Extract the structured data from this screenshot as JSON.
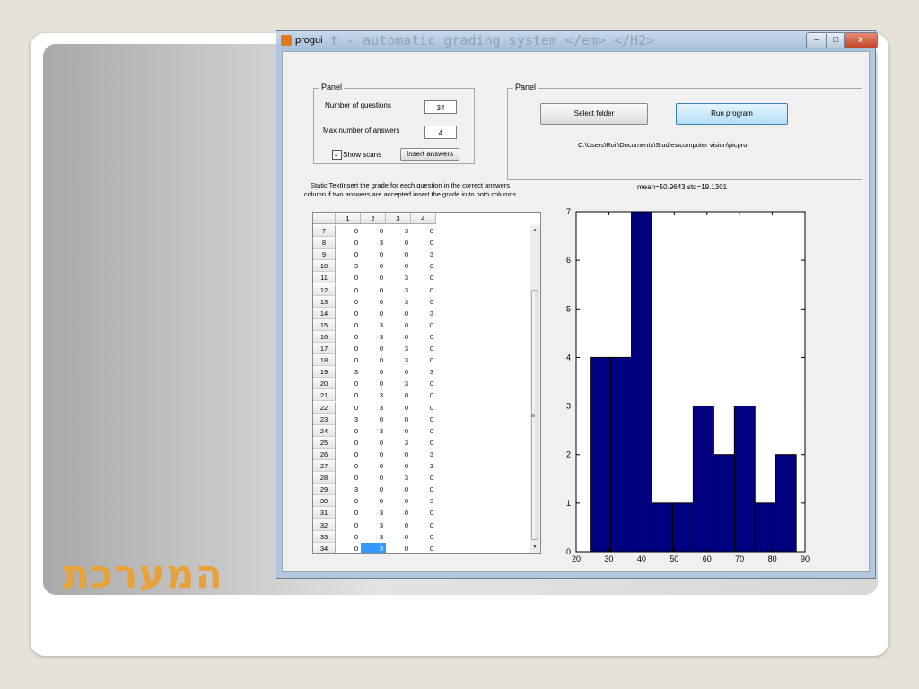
{
  "slide": {
    "title": "המערכת"
  },
  "window": {
    "title": "progui",
    "ghost_text": "t - automatic grading system </em> </H2>",
    "minimize": "–",
    "maximize": "□",
    "close": "x"
  },
  "left_panel": {
    "label": "Panel",
    "num_questions_label": "Number of questions",
    "num_questions_value": "34",
    "max_answers_label": "Max number of answers",
    "max_answers_value": "4",
    "show_scans_label": "Show scans",
    "show_scans_checked": true,
    "insert_answers_label": "Insert answers"
  },
  "right_panel": {
    "label": "Panel",
    "select_folder_label": "Select folder",
    "run_program_label": "Run program",
    "path": "C:\\Users\\Roii\\Documents\\Studies\\computer vision\\picpro"
  },
  "instructions": "Static TextInsert the grade for each question in the correct answers column if two answers are accepted insert the grade in to both columns",
  "stats": "mean=50.9643  std=19.1301",
  "table": {
    "columns": [
      "1",
      "2",
      "3",
      "4"
    ],
    "rows": [
      {
        "label": "7",
        "cells": [
          "0",
          "0",
          "3",
          "0"
        ]
      },
      {
        "label": "8",
        "cells": [
          "0",
          "3",
          "0",
          "0"
        ]
      },
      {
        "label": "9",
        "cells": [
          "0",
          "0",
          "0",
          "3"
        ]
      },
      {
        "label": "10",
        "cells": [
          "3",
          "0",
          "0",
          "0"
        ]
      },
      {
        "label": "11",
        "cells": [
          "0",
          "0",
          "3",
          "0"
        ]
      },
      {
        "label": "12",
        "cells": [
          "0",
          "0",
          "3",
          "0"
        ]
      },
      {
        "label": "13",
        "cells": [
          "0",
          "0",
          "3",
          "0"
        ]
      },
      {
        "label": "14",
        "cells": [
          "0",
          "0",
          "0",
          "3"
        ]
      },
      {
        "label": "15",
        "cells": [
          "0",
          "3",
          "0",
          "0"
        ]
      },
      {
        "label": "16",
        "cells": [
          "0",
          "3",
          "0",
          "0"
        ]
      },
      {
        "label": "17",
        "cells": [
          "0",
          "0",
          "3",
          "0"
        ]
      },
      {
        "label": "18",
        "cells": [
          "0",
          "0",
          "3",
          "0"
        ]
      },
      {
        "label": "19",
        "cells": [
          "3",
          "0",
          "0",
          "3"
        ]
      },
      {
        "label": "20",
        "cells": [
          "0",
          "0",
          "3",
          "0"
        ]
      },
      {
        "label": "21",
        "cells": [
          "0",
          "3",
          "0",
          "0"
        ]
      },
      {
        "label": "22",
        "cells": [
          "0",
          "3",
          "0",
          "0"
        ]
      },
      {
        "label": "23",
        "cells": [
          "3",
          "0",
          "0",
          "0"
        ]
      },
      {
        "label": "24",
        "cells": [
          "0",
          "3",
          "0",
          "0"
        ]
      },
      {
        "label": "25",
        "cells": [
          "0",
          "0",
          "3",
          "0"
        ]
      },
      {
        "label": "26",
        "cells": [
          "0",
          "0",
          "0",
          "3"
        ]
      },
      {
        "label": "27",
        "cells": [
          "0",
          "0",
          "0",
          "3"
        ]
      },
      {
        "label": "28",
        "cells": [
          "0",
          "0",
          "3",
          "0"
        ]
      },
      {
        "label": "29",
        "cells": [
          "3",
          "0",
          "0",
          "0"
        ]
      },
      {
        "label": "30",
        "cells": [
          "0",
          "0",
          "0",
          "3"
        ]
      },
      {
        "label": "31",
        "cells": [
          "0",
          "3",
          "0",
          "0"
        ]
      },
      {
        "label": "32",
        "cells": [
          "0",
          "3",
          "0",
          "0"
        ]
      },
      {
        "label": "33",
        "cells": [
          "0",
          "3",
          "0",
          "0"
        ]
      },
      {
        "label": "34",
        "cells": [
          "0",
          "3",
          "0",
          "0"
        ]
      }
    ],
    "selected": {
      "row": 27,
      "col": 1
    }
  },
  "chart_data": {
    "type": "bar",
    "title": "",
    "xlabel": "",
    "ylabel": "",
    "bar_color": "#000080",
    "xlim": [
      20,
      90
    ],
    "ylim": [
      0,
      7
    ],
    "xticks": [
      20,
      30,
      40,
      50,
      60,
      70,
      80,
      90
    ],
    "yticks": [
      0,
      1,
      2,
      3,
      4,
      5,
      6,
      7
    ],
    "bins": [
      {
        "start": 24.3,
        "end": 30.6,
        "value": 4
      },
      {
        "start": 30.6,
        "end": 36.9,
        "value": 4
      },
      {
        "start": 36.9,
        "end": 43.2,
        "value": 7
      },
      {
        "start": 43.2,
        "end": 49.5,
        "value": 1
      },
      {
        "start": 49.5,
        "end": 55.8,
        "value": 1
      },
      {
        "start": 55.8,
        "end": 62.1,
        "value": 3
      },
      {
        "start": 62.1,
        "end": 68.4,
        "value": 2
      },
      {
        "start": 68.4,
        "end": 74.7,
        "value": 3
      },
      {
        "start": 74.7,
        "end": 81.0,
        "value": 1
      },
      {
        "start": 81.0,
        "end": 87.3,
        "value": 2
      }
    ]
  }
}
